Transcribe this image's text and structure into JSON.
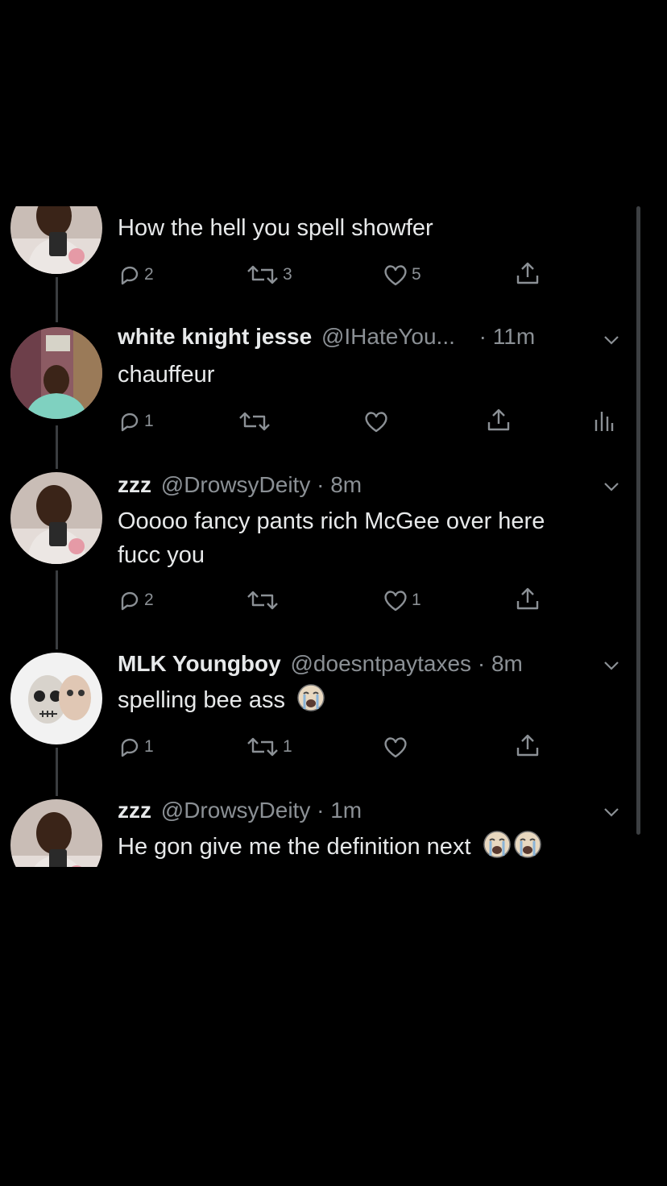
{
  "tweets": [
    {
      "text": "How the hell you spell showfer",
      "replies": "2",
      "retweets": "3",
      "likes": "5"
    },
    {
      "name": "white knight jesse",
      "handle": "@IHateYou...",
      "time": "· 11m",
      "text": "chauffeur",
      "replies": "1",
      "retweets": "",
      "likes": ""
    },
    {
      "name": "zzz",
      "handle": "@DrowsyDeity",
      "time": "· 8m",
      "text": "Ooooo fancy pants rich McGee over here",
      "text2": "fucc you",
      "replies": "2",
      "retweets": "",
      "likes": "1"
    },
    {
      "name": "MLK Youngboy",
      "handle": "@doesntpaytaxes",
      "time": "· 8m",
      "text": "spelling bee ass",
      "replies": "1",
      "retweets": "1",
      "likes": ""
    },
    {
      "name": "zzz",
      "handle": "@DrowsyDeity",
      "time": "· 1m",
      "text": "He gon give me the definition next"
    }
  ],
  "colors": {
    "background": "#000000",
    "text": "#e7e9ea",
    "muted": "#8b9095",
    "thread_line": "#3a3d40"
  },
  "icons": [
    "reply-icon",
    "retweet-icon",
    "like-icon",
    "share-icon",
    "analytics-icon",
    "chevron-down-icon",
    "loudly-crying-face-emoji"
  ]
}
